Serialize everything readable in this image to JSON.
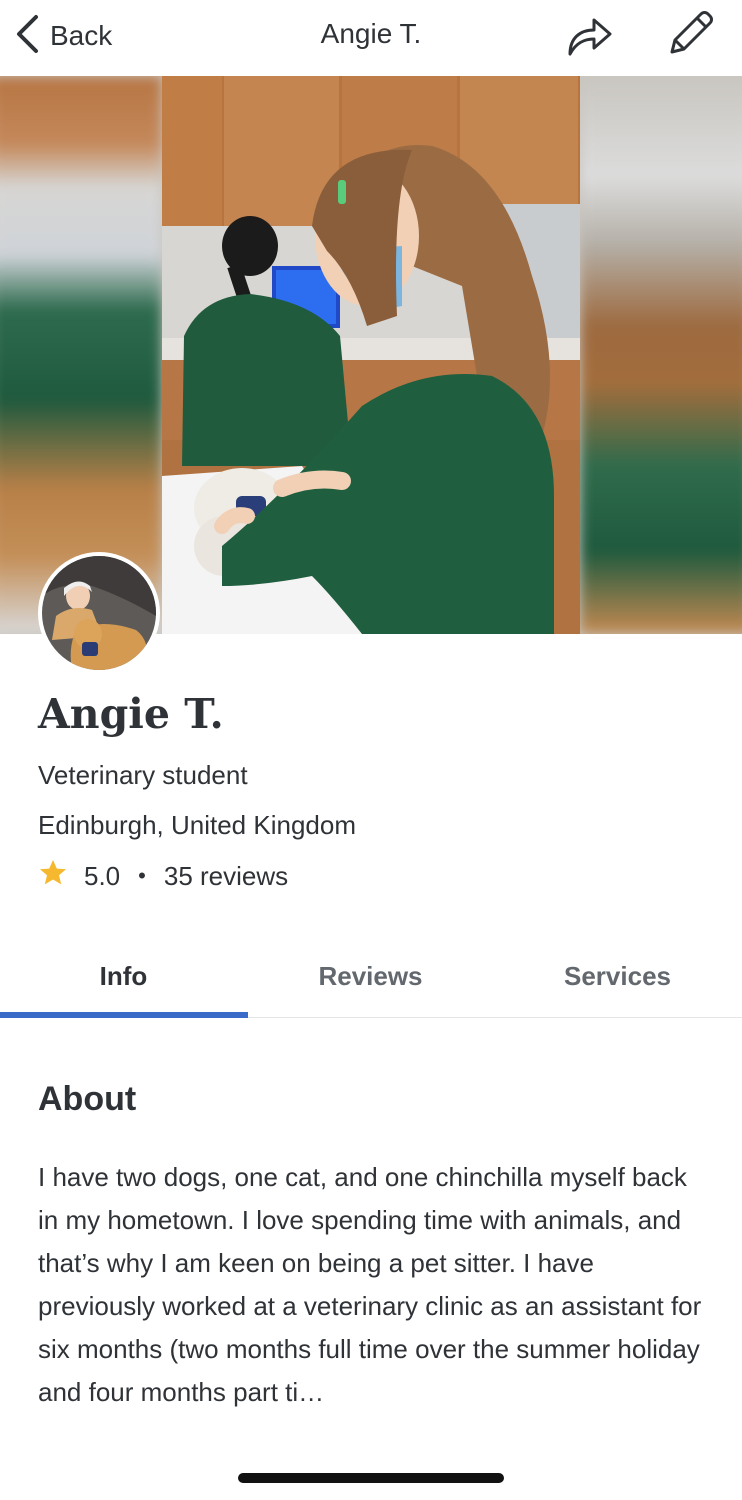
{
  "navbar": {
    "back_label": "Back",
    "title": "Angie T."
  },
  "profile": {
    "name": "Angie T.",
    "role": "Veterinary student",
    "location": "Edinburgh, United Kingdom",
    "rating": "5.0",
    "separator": "•",
    "reviews_count": "35 reviews",
    "star_color": "#f5b82e"
  },
  "tabs": [
    {
      "label": "Info",
      "active": true
    },
    {
      "label": "Reviews",
      "active": false
    },
    {
      "label": "Services",
      "active": false
    }
  ],
  "about": {
    "heading": "About",
    "text": "I have two dogs, one cat, and one chinchilla myself back in my hometown. I love spending time with animals, and that’s why I am keen on being a pet sitter. I have previously worked at a veterinary clinic as an assistant for six months (two months full time over the summer holiday and four months part ti…"
  },
  "colors": {
    "accent": "#3a6bc9",
    "text_primary": "#2f3337",
    "text_secondary": "#62686e"
  },
  "icons": {
    "back": "chevron-left-icon",
    "share": "share-icon",
    "edit": "pencil-icon",
    "rating": "star-icon"
  }
}
